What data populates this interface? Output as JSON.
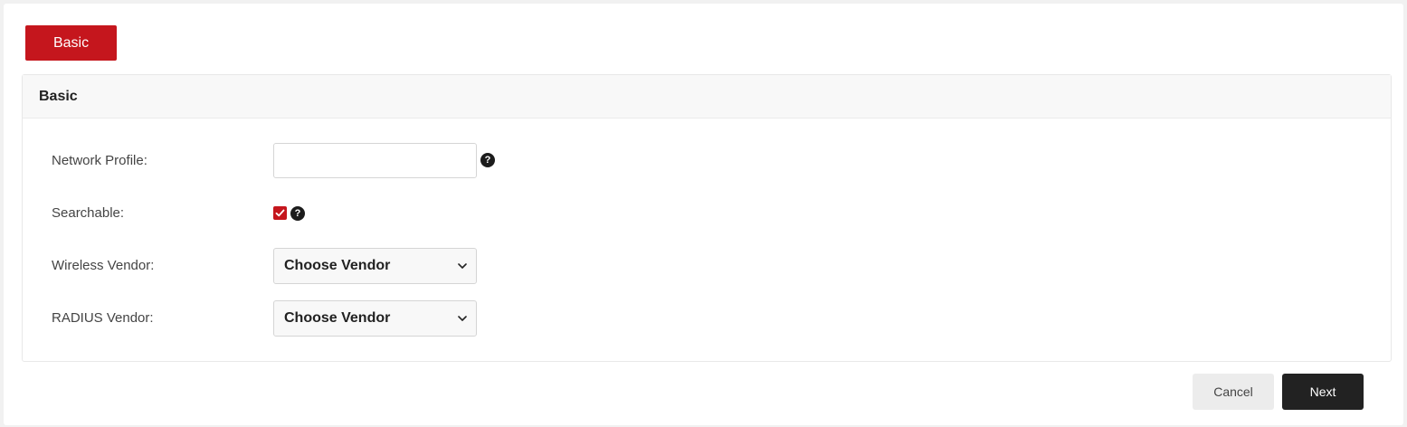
{
  "tab": {
    "label": "Basic"
  },
  "panel": {
    "title": "Basic"
  },
  "form": {
    "network_profile": {
      "label": "Network Profile:",
      "value": "",
      "help": "?"
    },
    "searchable": {
      "label": "Searchable:",
      "checked": true,
      "help": "?"
    },
    "wireless_vendor": {
      "label": "Wireless Vendor:",
      "selected": "Choose Vendor"
    },
    "radius_vendor": {
      "label": "RADIUS Vendor:",
      "selected": "Choose Vendor"
    }
  },
  "actions": {
    "cancel_label": "Cancel",
    "next_label": "Next"
  },
  "colors": {
    "accent": "#c5161d",
    "primary_button": "#222222",
    "secondary_button": "#ececec"
  }
}
